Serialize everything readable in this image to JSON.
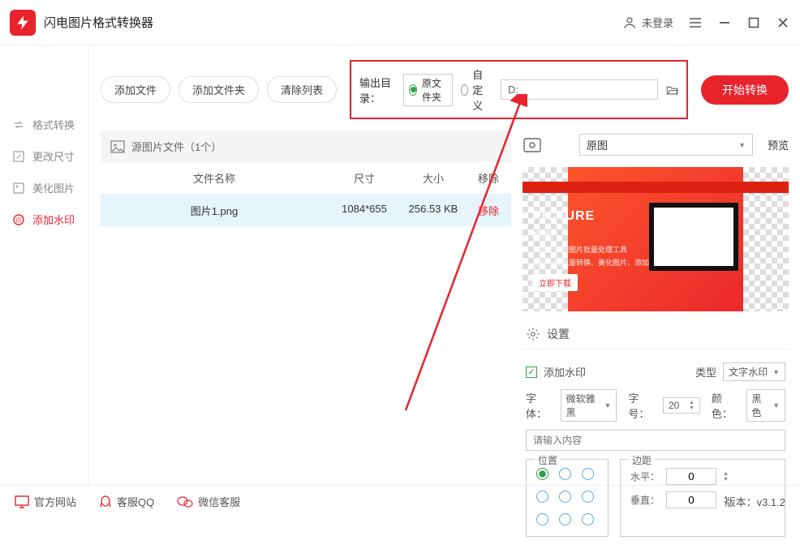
{
  "titlebar": {
    "app_title": "闪电图片格式转换器",
    "login": "未登录"
  },
  "sidebar": {
    "items": [
      {
        "label": "格式转换"
      },
      {
        "label": "更改尺寸"
      },
      {
        "label": "美化图片"
      },
      {
        "label": "添加水印"
      }
    ]
  },
  "toolbar": {
    "add_file": "添加文件",
    "add_folder": "添加文件夹",
    "clear_list": "清除列表",
    "output_label": "输出目录：",
    "opt_original": "原文件夹",
    "opt_custom": "自定义",
    "path": "D:",
    "start": "开始转换"
  },
  "source": {
    "header": "源图片文件（1个）",
    "cols": {
      "name": "文件名称",
      "size": "尺寸",
      "bytes": "大小",
      "remove": "移除"
    },
    "rows": [
      {
        "name": "图片1.png",
        "size": "1084*655",
        "bytes": "256.53 KB",
        "remove": "移除"
      }
    ]
  },
  "preview": {
    "select_label": "原图",
    "title": "预览",
    "inner": {
      "picture": "PICTURE",
      "sub": "超赞！",
      "desc1": "一款全新的图片批量处理工具",
      "desc2": "支持一键批量转换、美化图片、添加水印等功能",
      "download": "立即下载"
    }
  },
  "settings": {
    "title": "设置",
    "add_watermark": "添加水印",
    "type_label": "类型",
    "type_value": "文字水印",
    "font_label": "字体：",
    "font_value": "微软雅黑",
    "size_label": "字号：",
    "size_value": "20",
    "color_label": "颜色：",
    "color_value": "黑色",
    "text_placeholder": "请输入内容",
    "position_label": "位置",
    "margin_label": "边距",
    "h_label": "水平：",
    "h_value": "0",
    "v_label": "垂直：",
    "v_value": "0"
  },
  "footer": {
    "website": "官方网站",
    "qq": "客服QQ",
    "wechat": "微信客服",
    "version": "版本：v3.1.2"
  }
}
